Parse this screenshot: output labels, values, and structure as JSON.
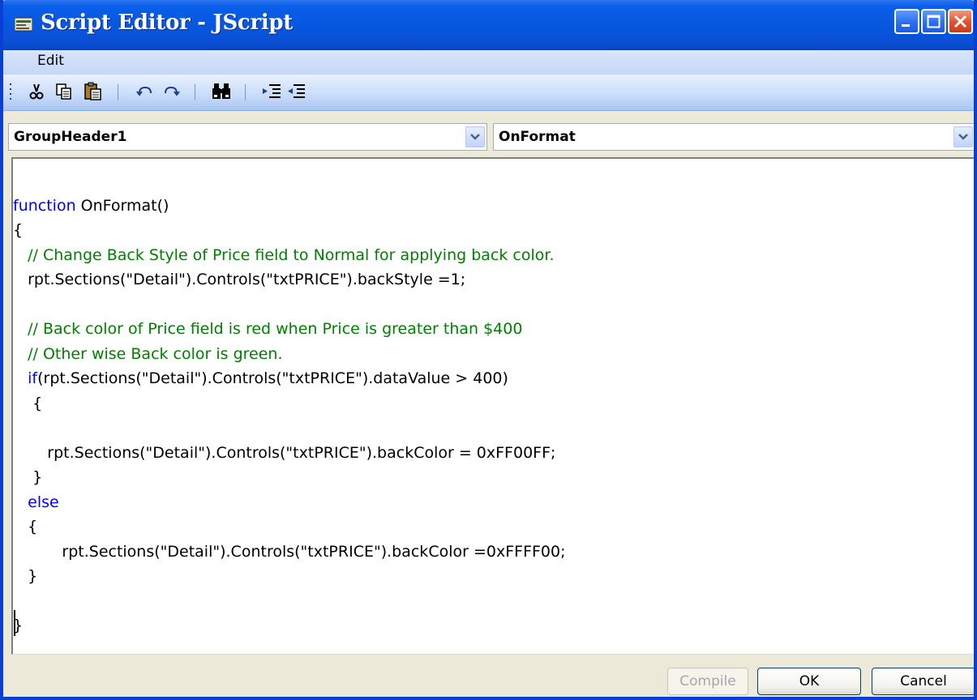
{
  "window": {
    "title": "Script Editor - JScript"
  },
  "menu": {
    "items": [
      "Edit"
    ]
  },
  "toolbar": {
    "buttons": [
      "cut",
      "copy",
      "paste",
      "undo",
      "redo",
      "find",
      "indent",
      "outdent"
    ]
  },
  "object_combo": {
    "value": "GroupHeader1"
  },
  "event_combo": {
    "value": "OnFormat"
  },
  "code_lines": [
    "",
    "function OnFormat()",
    "{",
    "   // Change Back Style of Price field to Normal for applying back color.",
    "   rpt.Sections(\"Detail\").Controls(\"txtPRICE\").backStyle =1;",
    "",
    "   // Back color of Price field is red when Price is greater than $400",
    "   // Other wise Back color is green.",
    "   if(rpt.Sections(\"Detail\").Controls(\"txtPRICE\").dataValue > 400)",
    "    {",
    "",
    "       rpt.Sections(\"Detail\").Controls(\"txtPRICE\").backColor = 0xFF00FF;",
    "    }",
    "   else",
    "   {",
    "          rpt.Sections(\"Detail\").Controls(\"txtPRICE\").backColor =0xFFFF00;",
    "   }",
    "",
    "}"
  ],
  "buttons": {
    "compile": "Compile",
    "ok": "OK",
    "cancel": "Cancel"
  },
  "colors": {
    "keyword": "#0000ff",
    "comment": "#008000",
    "titlebar": "#0a57e0"
  }
}
